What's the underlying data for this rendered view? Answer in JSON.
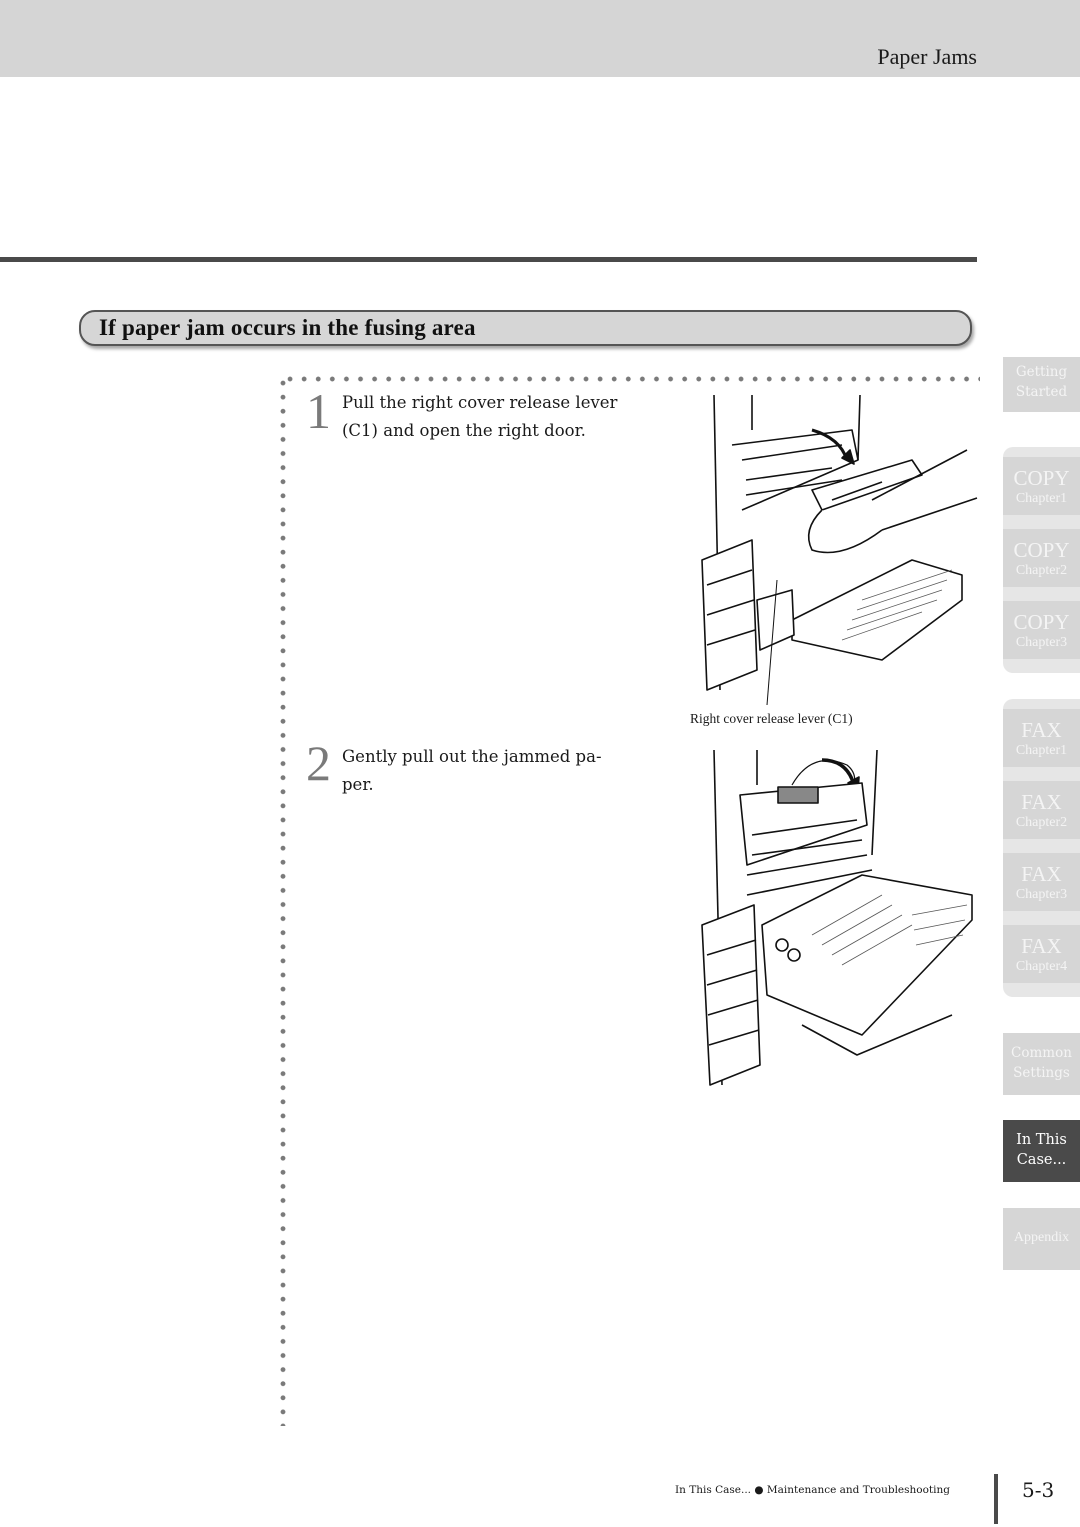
{
  "header": {
    "title": "Paper Jams"
  },
  "section": {
    "title": "If paper jam occurs in the fusing area"
  },
  "steps": [
    {
      "number": "1",
      "line1": "Pull the right cover release lever",
      "line2": "(C1) and open the right door."
    },
    {
      "number": "2",
      "line1": "Gently pull out the jammed pa-",
      "line2": "per."
    }
  ],
  "figures": [
    {
      "icon": "copier-right-door-open-illustration",
      "caption": "Right cover release lever (C1)"
    },
    {
      "icon": "fusing-unit-jammed-paper-illustration",
      "caption": ""
    }
  ],
  "sidebar": {
    "tabs": [
      {
        "main": "Getting",
        "sub": "Started"
      },
      {
        "main": "COPY",
        "sub": "Chapter1"
      },
      {
        "main": "COPY",
        "sub": "Chapter2"
      },
      {
        "main": "COPY",
        "sub": "Chapter3"
      },
      {
        "main": "FAX",
        "sub": "Chapter1"
      },
      {
        "main": "FAX",
        "sub": "Chapter2"
      },
      {
        "main": "FAX",
        "sub": "Chapter3"
      },
      {
        "main": "FAX",
        "sub": "Chapter4"
      },
      {
        "main": "Common",
        "sub": "Settings"
      },
      {
        "main": "In This",
        "sub": "Case...",
        "active": true
      },
      {
        "main": "Appendix",
        "sub": ""
      }
    ]
  },
  "footer": {
    "breadcrumb_section": "In This Case...",
    "separator": "●",
    "breadcrumb_chapter": "Maintenance and Troubleshooting",
    "page_number": "5-3"
  },
  "colors": {
    "header_band": "#d5d5d5",
    "tab_inactive": "#d6d6d6",
    "tab_active": "#4a4a4a",
    "rule": "#4a4a4a"
  }
}
